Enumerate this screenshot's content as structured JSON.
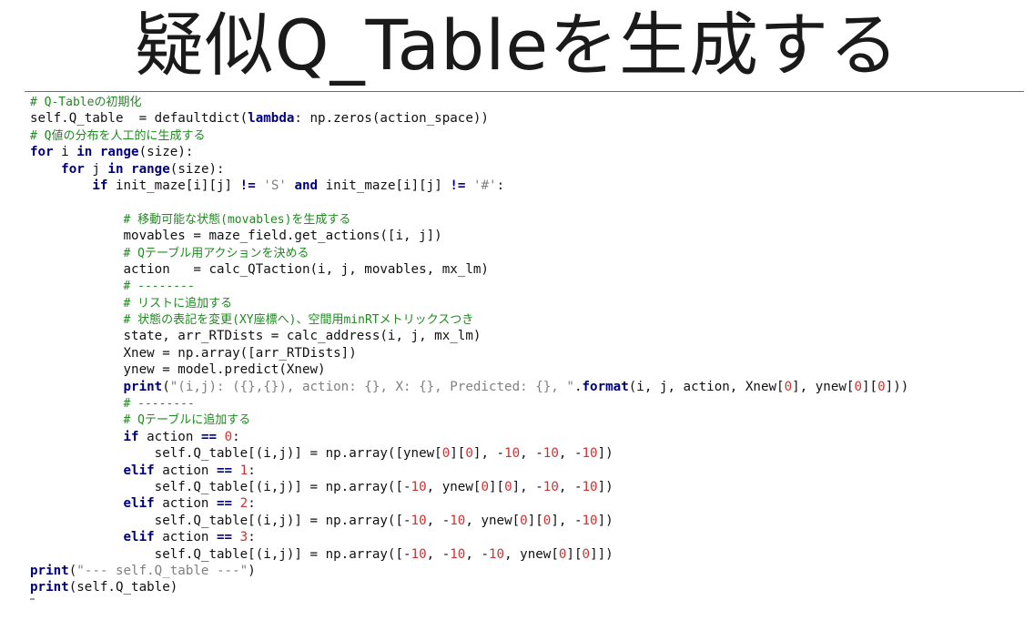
{
  "title": "疑似Q_Tableを生成する",
  "code_lines": [
    {
      "indent": 0,
      "tokens": [
        {
          "t": "# Q-Tableの初期化",
          "c": "cm"
        }
      ]
    },
    {
      "indent": 0,
      "tokens": [
        {
          "t": "self.Q_table  = defaultdict(",
          "c": ""
        },
        {
          "t": "lambda",
          "c": "kw"
        },
        {
          "t": ": np.zeros(action_space))",
          "c": ""
        }
      ]
    },
    {
      "indent": 0,
      "tokens": [
        {
          "t": "# Q値の分布を人工的に生成する",
          "c": "cm"
        }
      ]
    },
    {
      "indent": 0,
      "tokens": [
        {
          "t": "for",
          "c": "kw"
        },
        {
          "t": " i ",
          "c": ""
        },
        {
          "t": "in",
          "c": "kw"
        },
        {
          "t": " ",
          "c": ""
        },
        {
          "t": "range",
          "c": "kw"
        },
        {
          "t": "(size):",
          "c": ""
        }
      ]
    },
    {
      "indent": 4,
      "tokens": [
        {
          "t": "for",
          "c": "kw"
        },
        {
          "t": " j ",
          "c": ""
        },
        {
          "t": "in",
          "c": "kw"
        },
        {
          "t": " ",
          "c": ""
        },
        {
          "t": "range",
          "c": "kw"
        },
        {
          "t": "(size):",
          "c": ""
        }
      ]
    },
    {
      "indent": 8,
      "tokens": [
        {
          "t": "if",
          "c": "kw"
        },
        {
          "t": " init_maze[i][j] ",
          "c": ""
        },
        {
          "t": "!=",
          "c": "kw"
        },
        {
          "t": " ",
          "c": ""
        },
        {
          "t": "'S'",
          "c": "str"
        },
        {
          "t": " ",
          "c": ""
        },
        {
          "t": "and",
          "c": "kw"
        },
        {
          "t": " init_maze[i][j] ",
          "c": ""
        },
        {
          "t": "!=",
          "c": "kw"
        },
        {
          "t": " ",
          "c": ""
        },
        {
          "t": "'#'",
          "c": "str"
        },
        {
          "t": ":",
          "c": ""
        }
      ]
    },
    {
      "indent": 0,
      "tokens": []
    },
    {
      "indent": 12,
      "tokens": [
        {
          "t": "# 移動可能な状態(movables)を生成する",
          "c": "cm"
        }
      ]
    },
    {
      "indent": 12,
      "tokens": [
        {
          "t": "movables = maze_field.get_actions([i, j])",
          "c": ""
        }
      ]
    },
    {
      "indent": 12,
      "tokens": [
        {
          "t": "# Qテーブル用アクションを決める",
          "c": "cm"
        }
      ]
    },
    {
      "indent": 12,
      "tokens": [
        {
          "t": "action   = calc_QTaction(i, j, movables, mx_lm)",
          "c": ""
        }
      ]
    },
    {
      "indent": 12,
      "tokens": [
        {
          "t": "# --------",
          "c": "cm"
        }
      ]
    },
    {
      "indent": 12,
      "tokens": [
        {
          "t": "# リストに追加する",
          "c": "cm"
        }
      ]
    },
    {
      "indent": 12,
      "tokens": [
        {
          "t": "# 状態の表記を変更(XY座標へ)、空間用minRTメトリックスつき",
          "c": "cm"
        }
      ]
    },
    {
      "indent": 12,
      "tokens": [
        {
          "t": "state, arr_RTDists = calc_address(i, j, mx_lm)",
          "c": ""
        }
      ]
    },
    {
      "indent": 12,
      "tokens": [
        {
          "t": "Xnew = np.array([arr_RTDists])",
          "c": ""
        }
      ]
    },
    {
      "indent": 12,
      "tokens": [
        {
          "t": "ynew = model.predict(Xnew)",
          "c": ""
        }
      ]
    },
    {
      "indent": 12,
      "tokens": [
        {
          "t": "print",
          "c": "kw"
        },
        {
          "t": "(",
          "c": ""
        },
        {
          "t": "\"(i,j): ({},{}), action: {}, X: {}, Predicted: {}, \"",
          "c": "str"
        },
        {
          "t": ".",
          "c": ""
        },
        {
          "t": "format",
          "c": "kw"
        },
        {
          "t": "(i, j, action, Xnew[",
          "c": ""
        },
        {
          "t": "0",
          "c": "num"
        },
        {
          "t": "], ynew[",
          "c": ""
        },
        {
          "t": "0",
          "c": "num"
        },
        {
          "t": "][",
          "c": ""
        },
        {
          "t": "0",
          "c": "num"
        },
        {
          "t": "]))",
          "c": ""
        }
      ]
    },
    {
      "indent": 12,
      "tokens": [
        {
          "t": "# --------",
          "c": "cm"
        }
      ]
    },
    {
      "indent": 12,
      "tokens": [
        {
          "t": "# Qテーブルに追加する",
          "c": "cm"
        }
      ]
    },
    {
      "indent": 12,
      "tokens": [
        {
          "t": "if",
          "c": "kw"
        },
        {
          "t": " action ",
          "c": ""
        },
        {
          "t": "==",
          "c": "kw"
        },
        {
          "t": " ",
          "c": ""
        },
        {
          "t": "0",
          "c": "num"
        },
        {
          "t": ":",
          "c": ""
        }
      ]
    },
    {
      "indent": 16,
      "tokens": [
        {
          "t": "self.Q_table[(i,j)] = np.array([ynew[",
          "c": ""
        },
        {
          "t": "0",
          "c": "num"
        },
        {
          "t": "][",
          "c": ""
        },
        {
          "t": "0",
          "c": "num"
        },
        {
          "t": "], -",
          "c": ""
        },
        {
          "t": "10",
          "c": "num"
        },
        {
          "t": ", -",
          "c": ""
        },
        {
          "t": "10",
          "c": "num"
        },
        {
          "t": ", -",
          "c": ""
        },
        {
          "t": "10",
          "c": "num"
        },
        {
          "t": "])",
          "c": ""
        }
      ]
    },
    {
      "indent": 12,
      "tokens": [
        {
          "t": "elif",
          "c": "kw"
        },
        {
          "t": " action ",
          "c": ""
        },
        {
          "t": "==",
          "c": "kw"
        },
        {
          "t": " ",
          "c": ""
        },
        {
          "t": "1",
          "c": "num"
        },
        {
          "t": ":",
          "c": ""
        }
      ]
    },
    {
      "indent": 16,
      "tokens": [
        {
          "t": "self.Q_table[(i,j)] = np.array([-",
          "c": ""
        },
        {
          "t": "10",
          "c": "num"
        },
        {
          "t": ", ynew[",
          "c": ""
        },
        {
          "t": "0",
          "c": "num"
        },
        {
          "t": "][",
          "c": ""
        },
        {
          "t": "0",
          "c": "num"
        },
        {
          "t": "], -",
          "c": ""
        },
        {
          "t": "10",
          "c": "num"
        },
        {
          "t": ", -",
          "c": ""
        },
        {
          "t": "10",
          "c": "num"
        },
        {
          "t": "])",
          "c": ""
        }
      ]
    },
    {
      "indent": 12,
      "tokens": [
        {
          "t": "elif",
          "c": "kw"
        },
        {
          "t": " action ",
          "c": ""
        },
        {
          "t": "==",
          "c": "kw"
        },
        {
          "t": " ",
          "c": ""
        },
        {
          "t": "2",
          "c": "num"
        },
        {
          "t": ":",
          "c": ""
        }
      ]
    },
    {
      "indent": 16,
      "tokens": [
        {
          "t": "self.Q_table[(i,j)] = np.array([-",
          "c": ""
        },
        {
          "t": "10",
          "c": "num"
        },
        {
          "t": ", -",
          "c": ""
        },
        {
          "t": "10",
          "c": "num"
        },
        {
          "t": ", ynew[",
          "c": ""
        },
        {
          "t": "0",
          "c": "num"
        },
        {
          "t": "][",
          "c": ""
        },
        {
          "t": "0",
          "c": "num"
        },
        {
          "t": "], -",
          "c": ""
        },
        {
          "t": "10",
          "c": "num"
        },
        {
          "t": "])",
          "c": ""
        }
      ]
    },
    {
      "indent": 12,
      "tokens": [
        {
          "t": "elif",
          "c": "kw"
        },
        {
          "t": " action ",
          "c": ""
        },
        {
          "t": "==",
          "c": "kw"
        },
        {
          "t": " ",
          "c": ""
        },
        {
          "t": "3",
          "c": "num"
        },
        {
          "t": ":",
          "c": ""
        }
      ]
    },
    {
      "indent": 16,
      "tokens": [
        {
          "t": "self.Q_table[(i,j)] = np.array([-",
          "c": ""
        },
        {
          "t": "10",
          "c": "num"
        },
        {
          "t": ", -",
          "c": ""
        },
        {
          "t": "10",
          "c": "num"
        },
        {
          "t": ", -",
          "c": ""
        },
        {
          "t": "10",
          "c": "num"
        },
        {
          "t": ", ynew[",
          "c": ""
        },
        {
          "t": "0",
          "c": "num"
        },
        {
          "t": "][",
          "c": ""
        },
        {
          "t": "0",
          "c": "num"
        },
        {
          "t": "]])",
          "c": ""
        }
      ]
    },
    {
      "indent": 0,
      "tokens": [
        {
          "t": "print",
          "c": "kw"
        },
        {
          "t": "(",
          "c": ""
        },
        {
          "t": "\"--- self.Q_table ---\"",
          "c": "str"
        },
        {
          "t": ")",
          "c": ""
        }
      ]
    },
    {
      "indent": 0,
      "tokens": [
        {
          "t": "print",
          "c": "kw"
        },
        {
          "t": "(self.Q_table)",
          "c": ""
        }
      ]
    }
  ],
  "colors": {
    "keyword": "#000080",
    "string": "#808080",
    "number": "#cc3333",
    "comment": "#1f8a1f",
    "text": "#111111"
  }
}
